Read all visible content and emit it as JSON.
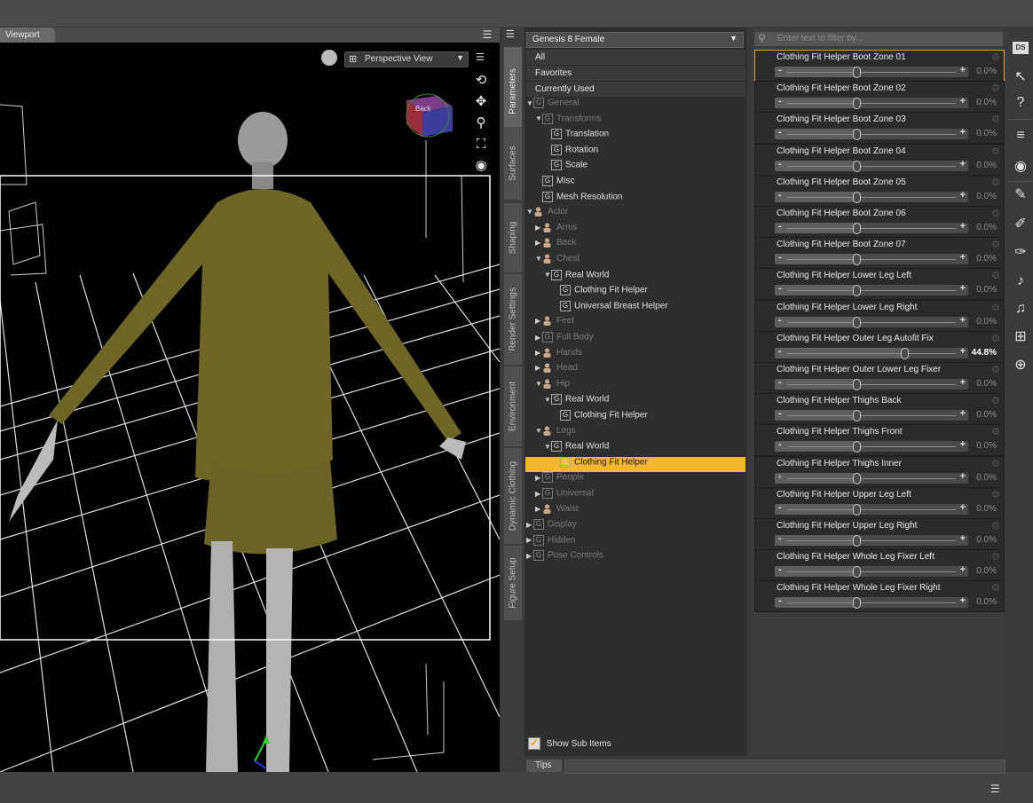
{
  "viewport": {
    "tab_label": "Viewport",
    "view_select": "Perspective View",
    "cube_label": "Back"
  },
  "side_tabs": [
    "Parameters",
    "Surfaces",
    "Shaping",
    "Render Settings",
    "Environment",
    "Dynamic Clothing",
    "Figure Setup"
  ],
  "tree": {
    "figure_select": "Genesis 8 Female",
    "categories": [
      "All",
      "Favorites",
      "Currently Used"
    ],
    "show_sub_items": "Show Sub Items",
    "items": [
      {
        "label": "General",
        "expand": "down",
        "icon": "group",
        "dim": true
      },
      {
        "label": "Transforms",
        "expand": "down",
        "icon": "group",
        "dim": true
      },
      {
        "label": "Translation",
        "expand": "",
        "icon": "group",
        "dim": false
      },
      {
        "label": "Rotation",
        "expand": "",
        "icon": "group",
        "dim": false
      },
      {
        "label": "Scale",
        "expand": "",
        "icon": "group",
        "dim": false
      },
      {
        "label": "Misc",
        "expand": "",
        "icon": "group",
        "dim": false
      },
      {
        "label": "Mesh Resolution",
        "expand": "",
        "icon": "group",
        "dim": false
      },
      {
        "label": "Actor",
        "expand": "down",
        "icon": "figure",
        "dim": true
      },
      {
        "label": "Arms",
        "expand": "right",
        "icon": "figure",
        "dim": true
      },
      {
        "label": "Back",
        "expand": "right",
        "icon": "figure",
        "dim": true
      },
      {
        "label": "Chest",
        "expand": "down",
        "icon": "figure",
        "dim": true
      },
      {
        "label": "Real World",
        "expand": "down",
        "icon": "group",
        "dim": false
      },
      {
        "label": "Clothing Fit Helper",
        "expand": "",
        "icon": "group",
        "dim": false
      },
      {
        "label": "Universal Breast Helper",
        "expand": "",
        "icon": "group",
        "dim": false
      },
      {
        "label": "Feet",
        "expand": "right",
        "icon": "figure",
        "dim": true
      },
      {
        "label": "Full Body",
        "expand": "right",
        "icon": "group",
        "dim": true
      },
      {
        "label": "Hands",
        "expand": "right",
        "icon": "figure",
        "dim": true
      },
      {
        "label": "Head",
        "expand": "right",
        "icon": "figure",
        "dim": true
      },
      {
        "label": "Hip",
        "expand": "down",
        "icon": "figure",
        "dim": true
      },
      {
        "label": "Real World",
        "expand": "down",
        "icon": "group",
        "dim": false
      },
      {
        "label": "Clothing Fit Helper",
        "expand": "",
        "icon": "group",
        "dim": false
      },
      {
        "label": "Legs",
        "expand": "down",
        "icon": "figure",
        "dim": true
      },
      {
        "label": "Real World",
        "expand": "down",
        "icon": "group",
        "dim": false
      },
      {
        "label": "Clothing Fit Helper",
        "expand": "",
        "icon": "group",
        "dim": false,
        "selected": true
      },
      {
        "label": "People",
        "expand": "right",
        "icon": "group",
        "dim": true
      },
      {
        "label": "Universal",
        "expand": "right",
        "icon": "group",
        "dim": true
      },
      {
        "label": "Waist",
        "expand": "right",
        "icon": "figure",
        "dim": true
      },
      {
        "label": "Display",
        "expand": "right",
        "icon": "group",
        "dim": true
      },
      {
        "label": "Hidden",
        "expand": "right",
        "icon": "group",
        "dim": true
      },
      {
        "label": "Pose Controls",
        "expand": "right",
        "icon": "group",
        "dim": true
      }
    ]
  },
  "filter": {
    "placeholder": "Enter text to filter by..."
  },
  "tips_label": "Tips",
  "sliders": [
    {
      "name": "Clothing Fit Helper Boot Zone 01",
      "value": "0.0%",
      "fraction": 0.0
    },
    {
      "name": "Clothing Fit Helper Boot Zone 02",
      "value": "0.0%",
      "fraction": 0.0
    },
    {
      "name": "Clothing Fit Helper Boot Zone 03",
      "value": "0.0%",
      "fraction": 0.0
    },
    {
      "name": "Clothing Fit Helper Boot Zone 04",
      "value": "0.0%",
      "fraction": 0.0
    },
    {
      "name": "Clothing Fit Helper Boot Zone 05",
      "value": "0.0%",
      "fraction": 0.0
    },
    {
      "name": "Clothing Fit Helper Boot Zone 06",
      "value": "0.0%",
      "fraction": 0.0
    },
    {
      "name": "Clothing Fit Helper Boot Zone 07",
      "value": "0.0%",
      "fraction": 0.0
    },
    {
      "name": "Clothing Fit Helper Lower Leg Left",
      "value": "0.0%",
      "fraction": 0.0
    },
    {
      "name": "Clothing Fit Helper Lower Leg Right",
      "value": "0.0%",
      "fraction": 0.0
    },
    {
      "name": "Clothing Fit Helper Outer Leg Autofit Fix",
      "value": "44.8%",
      "fraction": 0.448
    },
    {
      "name": "Clothing Fit Helper Outer Lower Leg Fixer",
      "value": "0.0%",
      "fraction": 0.0
    },
    {
      "name": "Clothing Fit Helper Thighs Back",
      "value": "0.0%",
      "fraction": 0.0
    },
    {
      "name": "Clothing Fit Helper Thighs Front",
      "value": "0.0%",
      "fraction": 0.0
    },
    {
      "name": "Clothing Fit Helper Thighs Inner",
      "value": "0.0%",
      "fraction": 0.0
    },
    {
      "name": "Clothing Fit Helper Upper Leg Left",
      "value": "0.0%",
      "fraction": 0.0
    },
    {
      "name": "Clothing Fit Helper Upper Leg Right",
      "value": "0.0%",
      "fraction": 0.0
    },
    {
      "name": "Clothing Fit Helper Whole Leg Fixer Left",
      "value": "0.0%",
      "fraction": 0.0
    },
    {
      "name": "Clothing Fit Helper Whole Leg Fixer Right",
      "value": "0.0%",
      "fraction": 0.0
    }
  ],
  "right_toolbar": {
    "icons": [
      "ds-logo-icon",
      "whats-this-icon",
      "help-icon",
      "align-icon",
      "node-icon",
      "edit-icon",
      "paint-icon",
      "transform-icon",
      "pose-icon",
      "pose2-icon",
      "morph-icon",
      "world-icon"
    ],
    "ds_label": "DS"
  },
  "colors": {
    "accent": "#f2b72e",
    "coat": "#6e6527",
    "skin": "#b5b5b5"
  }
}
